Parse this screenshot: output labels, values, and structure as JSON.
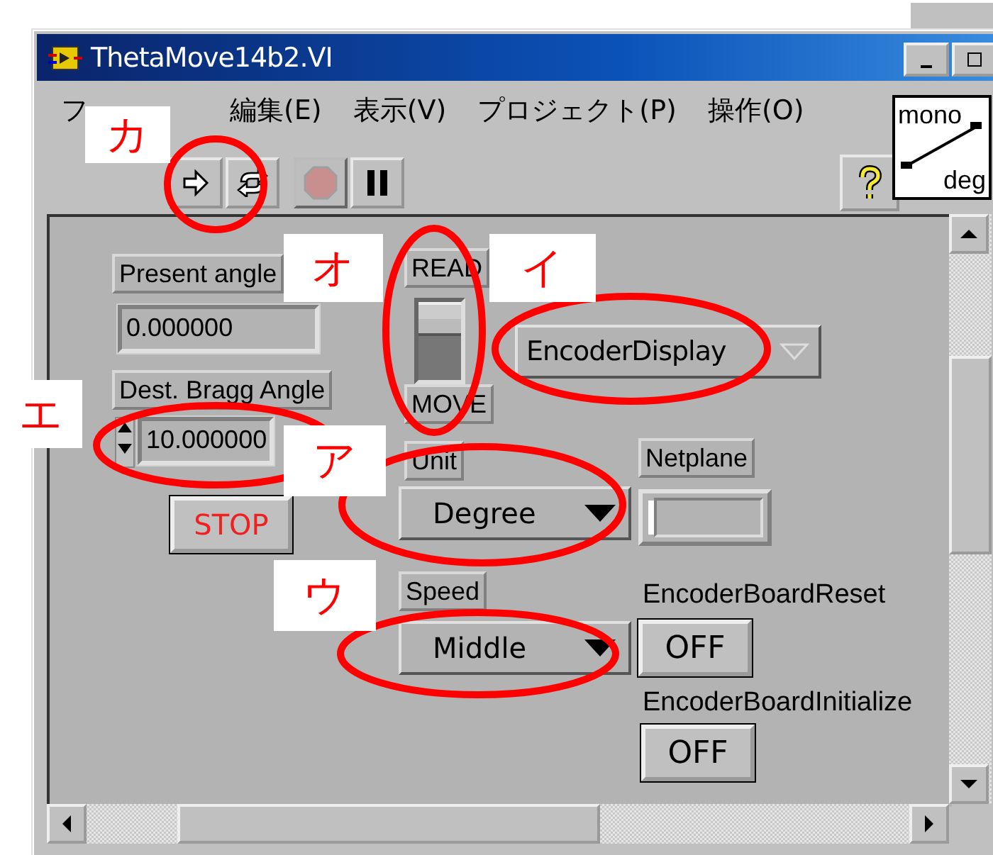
{
  "window": {
    "title": "ThetaMove14b2.VI"
  },
  "menu": [
    "フ",
    "編集(E)",
    "表示(V)",
    "プロジェクト(P)",
    "操作(O)"
  ],
  "toolbar": [
    {
      "kind": "run",
      "disabled": false
    },
    {
      "kind": "run-continuous",
      "disabled": false
    },
    {
      "kind": "abort",
      "disabled": true
    },
    {
      "kind": "pause",
      "disabled": false
    },
    {
      "kind": "help",
      "disabled": false
    }
  ],
  "connector_pane": {
    "top": "mono",
    "bottom": "deg"
  },
  "present_angle": {
    "label": "Present angle",
    "value": "0.000000"
  },
  "dest_bragg_angle": {
    "label": "Dest. Bragg Angle",
    "value": "10.000000"
  },
  "stop_button": {
    "text": "STOP"
  },
  "mode_switch": {
    "top_label": "READ",
    "bottom_label": "MOVE",
    "on": false
  },
  "encoder_display": {
    "value": "EncoderDisplay",
    "disabled": true
  },
  "unit": {
    "label": "Unit",
    "value": "Degree"
  },
  "netplane": {
    "label": "Netplane"
  },
  "speed": {
    "label": "Speed",
    "value": "Middle"
  },
  "encoder_board_reset": {
    "label": "EncoderBoardReset",
    "text": "OFF"
  },
  "encoder_board_initialize": {
    "label": "EncoderBoardInitialize",
    "text": "OFF"
  },
  "annotations": [
    "カ",
    "オ",
    "イ",
    "エ",
    "ア",
    "ウ"
  ]
}
